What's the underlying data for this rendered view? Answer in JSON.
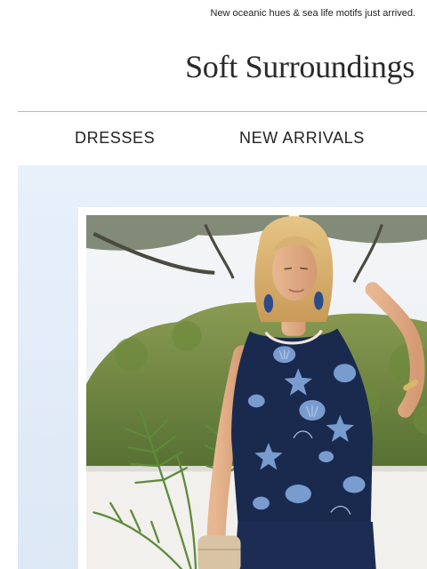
{
  "preheader": {
    "text": "New oceanic hues & sea life motifs just arrived."
  },
  "brand": {
    "logo_text": "Soft Surroundings"
  },
  "nav": {
    "items": [
      {
        "label": "DRESSES"
      },
      {
        "label": "NEW ARRIVALS"
      }
    ]
  },
  "hero": {
    "image": "model-sea-life-tank-photo",
    "colors": {
      "background": "#e8f0fa",
      "top_navy": "#1a2a4f",
      "print_blue": "#7fa3d6"
    }
  }
}
